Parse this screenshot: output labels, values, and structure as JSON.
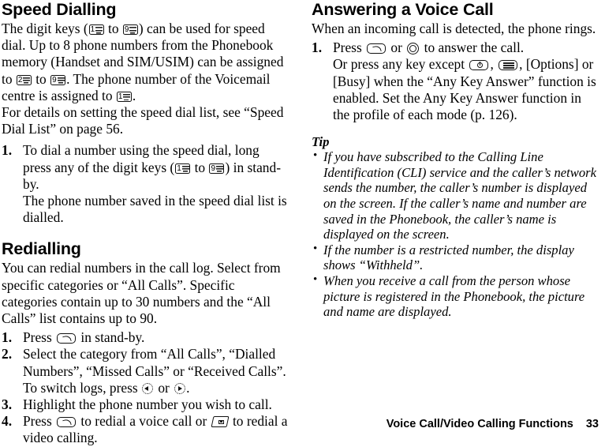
{
  "page": {
    "number": "33",
    "footer_title": "Voice Call/Video Calling Functions"
  },
  "left_column": {
    "section1": {
      "heading": "Speed Dialling",
      "para1_a": "The digit keys (",
      "para1_b": " to ",
      "para1_c": ") can be used for speed dial. Up to 8 phone numbers from the Phonebook memory (Handset and SIM/USIM) can be assigned to ",
      "para1_d": " to ",
      "para1_e": ". The phone number of the Voicemail centre is assigned to ",
      "para1_f": ".",
      "para2": "For details on setting the speed dial list, see “Speed Dial List” on page 56.",
      "steps": [
        {
          "num": "1.",
          "text_a": "To dial a number using the speed dial, long press any of the digit keys (",
          "text_b": " to ",
          "text_c": ") in stand-by.",
          "substep": "The phone number saved in the speed dial list is dialled."
        }
      ]
    },
    "section2": {
      "heading": "Redialling",
      "para1": "You can redial numbers in the call log. Select from specific categories or “All Calls”. Specific categories contain up to 30 numbers and the “All Calls” list contains up to 90.",
      "steps": [
        {
          "num": "1.",
          "text_a": "Press ",
          "text_b": " in stand-by."
        },
        {
          "num": "2.",
          "text_a": "Select the category from “All Calls”, “Dialled Numbers”, “Missed Calls” or “Received Calls”.",
          "substep_a": "To switch logs, press ",
          "substep_b": " or ",
          "substep_c": "."
        },
        {
          "num": "3.",
          "text_a": "Highlight the phone number you wish to call."
        },
        {
          "num": "4.",
          "text_a": "Press ",
          "text_b": " to redial a voice call or ",
          "text_c": " to redial a video calling."
        }
      ]
    }
  },
  "right_column": {
    "section1": {
      "heading": "Answering a Voice Call",
      "para1": "When an incoming call is detected, the phone rings.",
      "steps": [
        {
          "num": "1.",
          "text_a": "Press ",
          "text_b": " or ",
          "text_c": " to answer the call.",
          "substep_a": "Or press any key except ",
          "substep_b": ", ",
          "substep_c": ", [Options] or [Busy] when the “Any Key Answer” function is enabled. Set the Any Key Answer function in the profile of each mode (p. 126)."
        }
      ]
    },
    "tip": {
      "heading": "Tip",
      "items": [
        "If you have subscribed to the Calling Line Identification (CLI) service and the caller’s network sends the number, the caller’s number is displayed on the screen. If the caller’s name and number are saved in the Phonebook, the caller’s name is displayed on the screen.",
        "If the number is a restricted number, the display shows “Withheld”.",
        "When you receive a call from the person whose picture is registered in the Phonebook, the picture and name are displayed."
      ]
    }
  },
  "icons": {
    "digit_1": "1",
    "digit_2": "2",
    "digit_9": "9",
    "send_key": "send-key-icon",
    "end_key": "end-key-icon",
    "clear_key": "clear-key-icon",
    "video_key": "video-call-key-icon",
    "center_key": "center-key-icon",
    "nav_left": "nav-left-icon",
    "nav_right": "nav-right-icon",
    "bullet": "•"
  }
}
